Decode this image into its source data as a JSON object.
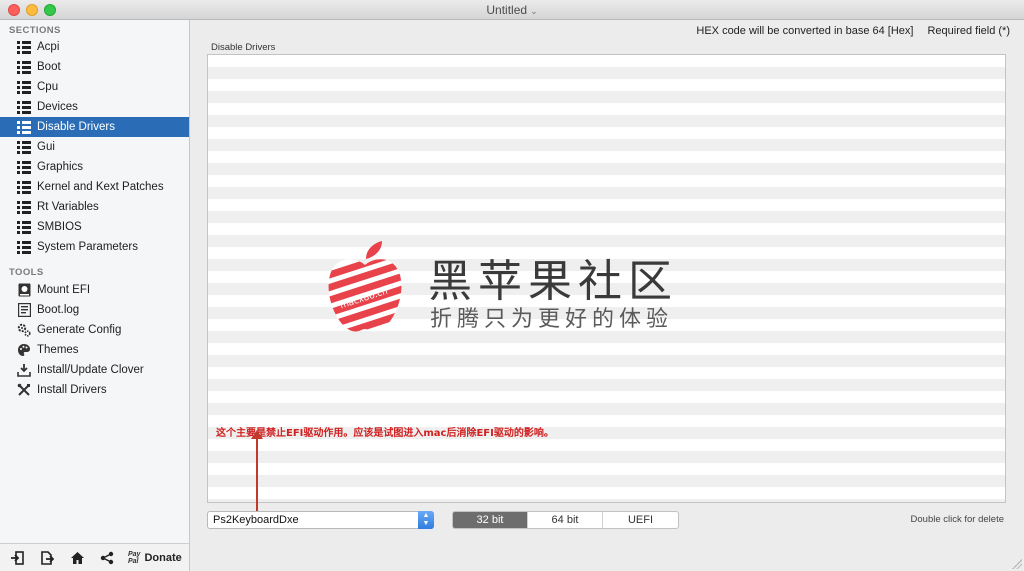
{
  "window": {
    "title": "Untitled",
    "title_chevron": "⌄"
  },
  "sidebar": {
    "sections_header": "SECTIONS",
    "sections": [
      {
        "label": "Acpi",
        "selected": false
      },
      {
        "label": "Boot",
        "selected": false
      },
      {
        "label": "Cpu",
        "selected": false
      },
      {
        "label": "Devices",
        "selected": false
      },
      {
        "label": "Disable Drivers",
        "selected": true
      },
      {
        "label": "Gui",
        "selected": false
      },
      {
        "label": "Graphics",
        "selected": false
      },
      {
        "label": "Kernel and Kext Patches",
        "selected": false
      },
      {
        "label": "Rt Variables",
        "selected": false
      },
      {
        "label": "SMBIOS",
        "selected": false
      },
      {
        "label": "System Parameters",
        "selected": false
      }
    ],
    "tools_header": "TOOLS",
    "tools": [
      {
        "label": "Mount EFI",
        "icon": "disk-icon"
      },
      {
        "label": "Boot.log",
        "icon": "log-icon"
      },
      {
        "label": "Generate Config",
        "icon": "gears-icon"
      },
      {
        "label": "Themes",
        "icon": "palette-icon"
      },
      {
        "label": "Install/Update Clover",
        "icon": "download-icon"
      },
      {
        "label": "Install Drivers",
        "icon": "tools-icon"
      }
    ],
    "bottom": {
      "paypal_line1": "Pay",
      "paypal_line2": "Pal",
      "donate_label": "Donate"
    }
  },
  "main": {
    "hex_note": "HEX code will be converted in base 64 [Hex]",
    "required_note": "Required field (*)",
    "group_label": "Disable Drivers",
    "watermark": {
      "logo_text": "macx86.cn",
      "title": "黑苹果社区",
      "subtitle": "折腾只为更好的体验"
    },
    "annotation": "这个主要是禁止EFI驱动作用。应该是试图进入mac后消除EFI驱动的影响。",
    "driver_combo": {
      "value": "Ps2KeyboardDxe",
      "arrow_up": "▲",
      "arrow_down": "▼"
    },
    "segments": [
      {
        "label": "32 bit",
        "active": true
      },
      {
        "label": "64 bit",
        "active": false
      },
      {
        "label": "UEFI",
        "active": false
      }
    ],
    "hint": "Double click for delete"
  },
  "colors": {
    "selection": "#2a6db6",
    "watermark_red": "#e8434a",
    "annotation_red": "#d02020"
  }
}
